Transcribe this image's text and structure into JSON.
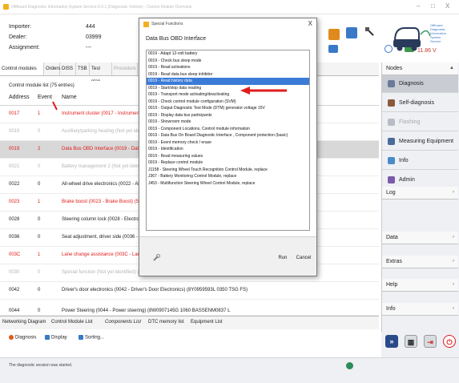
{
  "window": {
    "title": "Offboard Diagnostic Information System Service 6.0.1 (Diagnostic Vehicle) - Control Module Overview",
    "min_label": "–",
    "max_label": "□",
    "close_label": "X"
  },
  "vehicle_info": {
    "importer_label": "Importer:",
    "importer_value": "444",
    "dealer_label": "Dealer:",
    "dealer_value": "03999",
    "assignment_label": "Assignment:",
    "assignment_value": "---"
  },
  "toolbar": {
    "voltage": "11.86 V"
  },
  "logo": {
    "lines": [
      "Offboard",
      "Diagnostic",
      "Information",
      "System",
      "Service"
    ]
  },
  "tabs": [
    "Control modules",
    "Orders",
    "DISS",
    "TSB",
    "Test plan",
    "Procedure",
    "Sp"
  ],
  "module_list": {
    "title": "Control module list (75 entries)",
    "columns": [
      "Address",
      "Event",
      "Name"
    ],
    "rows": [
      {
        "address": "0017",
        "event": "1",
        "name": "Instrument cluster (0017 - Instrument clus",
        "style": "red"
      },
      {
        "address": "0019",
        "event": "0",
        "name": "Auxiliary/parking heating (Not yet identifie",
        "style": "gray"
      },
      {
        "address": "0019",
        "event": "2",
        "name": "Data Bus OBD Interface (0019 - Data Bu",
        "style": "red"
      },
      {
        "address": "0021",
        "event": "0",
        "name": "Battery management 2 (Not yet identified",
        "style": "gray"
      },
      {
        "address": "0022",
        "event": "0",
        "name": "All-wheel drive electronics (0022 - All-Wh",
        "style": "dark"
      },
      {
        "address": "0023",
        "event": "1",
        "name": "Brake boost (0023 - Brake Boost) (5WA0",
        "style": "red"
      },
      {
        "address": "0028",
        "event": "0",
        "name": "Steering column lock (0028 - Electronic s",
        "style": "dark"
      },
      {
        "address": "0036",
        "event": "0",
        "name": "Seat adjustment, driver side (0036 - Drive",
        "style": "dark"
      },
      {
        "address": "003C",
        "event": "1",
        "name": "Lane change assistance (003C - Lane ch",
        "style": "red"
      },
      {
        "address": "0030",
        "event": "0",
        "name": "Special function (Not yet identified) (--",
        "style": "gray"
      },
      {
        "address": "0042",
        "event": "0",
        "name": "Driver's door electronics (0042 - Driver's Door Electronics) (8Y0959593L   0350   TSG FS)",
        "style": "dark"
      },
      {
        "address": "0044",
        "event": "0",
        "name": "Power Steering (0044 - Power steering) (8W0907145G   1060   BASSENM0837 L",
        "style": "dark"
      }
    ]
  },
  "bottom_tabs": [
    "Networking Diagram",
    "Control Module List",
    "Components List",
    "DTC memory list",
    "Equipment List"
  ],
  "status_items": [
    "Diagnosis",
    "Display",
    "Sorting..."
  ],
  "footer_message": "The diagnostic session was started.",
  "right_panel": {
    "nodes_label": "Nodes",
    "items": [
      {
        "label": "Diagnosis",
        "active": true,
        "disabled": false,
        "color": "#6a7a98"
      },
      {
        "label": "Self-diagnosis",
        "active": false,
        "disabled": false,
        "color": "#8a5a3a"
      },
      {
        "label": "Flashing",
        "active": false,
        "disabled": true,
        "color": "#b8bcc4"
      },
      {
        "label": "Measuring Equipment",
        "active": false,
        "disabled": false,
        "color": "#4a6a9a"
      },
      {
        "label": "Info",
        "active": false,
        "disabled": false,
        "color": "#4a8ac8"
      },
      {
        "label": "Admin",
        "active": false,
        "disabled": false,
        "color": "#7a5aa8"
      }
    ],
    "sections": [
      "Log",
      "Data",
      "Extras",
      "Help",
      "Info"
    ]
  },
  "dialog": {
    "title": "Special Functions",
    "close_label": "X",
    "heading": "Data Bus OBD Interface",
    "functions": [
      "0019 - Adapt 12-volt battery",
      "0019 - Check bus sleep mode",
      "0019 - Read activations",
      "0019 - Read data bus sleep inhibitor",
      "0019 - Read history data",
      "0019 - Start/stop data reading",
      "0019 - Transport mode activating/deactivating",
      "0019 -  Check control module configuration (SVM)",
      "0019 -  Output Diagnostic Test Mode (DTM)  generator voltage 15V",
      "0019 - Display data bus participants",
      "0019 - Showroom mode",
      "0019 - Component Locations, Control module information",
      "0019 - Data Bus On Board Diagnostic Interface ,  Component protection  (basic)",
      "0019 - Event memory check / erase",
      "0019 - Identification",
      "0019 - Read measuring values",
      "0019 - Replace control module",
      "J1158 - Steering Wheel Touch Recognition Control Module, replace",
      "J367 - Battery Monitoring Control Module, replace",
      "J453 - Multifunction Steering Wheel Control Module, replace"
    ],
    "selected_index": 4,
    "run_label": "Run",
    "cancel_label": "Cancel"
  }
}
